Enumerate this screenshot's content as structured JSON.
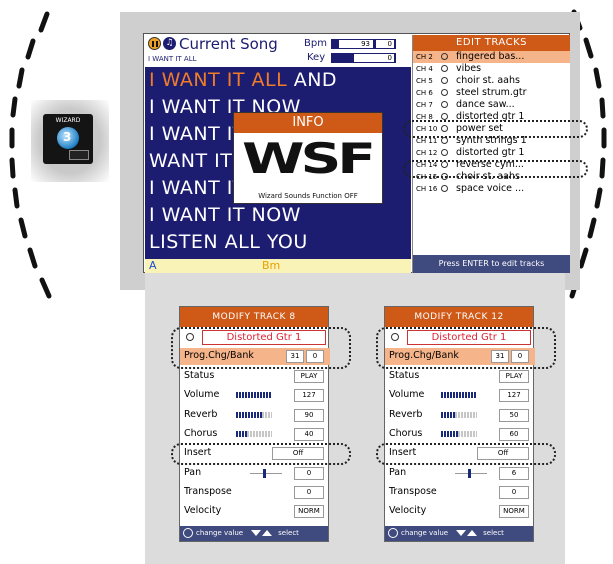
{
  "wizard": {
    "label": "WIZARD",
    "icon": "wizard-disc-icon"
  },
  "song": {
    "title": "Current Song",
    "subtitle": "I WANT IT ALL",
    "bpm_label": "Bpm",
    "bpm_value": "93",
    "bpm_extra": "0",
    "key_label": "Key",
    "key_value": "0",
    "lyrics": [
      {
        "hl": "I WANT IT ALL",
        "rest": " AND"
      },
      {
        "hl": "",
        "rest": "I WANT IT NOW"
      },
      {
        "hl": "",
        "rest": "I WANT IT ALL"
      },
      {
        "hl": "",
        "rest": "WANT IT ALL"
      },
      {
        "hl": "",
        "rest": "I WANT IT ALL AND"
      },
      {
        "hl": "",
        "rest": "I WANT IT NOW"
      },
      {
        "hl": "",
        "rest": "LISTEN ALL YOU"
      }
    ],
    "chord_current": "A",
    "chord_next": "Bm"
  },
  "info": {
    "title": "INFO",
    "logo": "WSF",
    "message": "Wizard Sounds Function OFF"
  },
  "tracks": {
    "title": "EDIT TRACKS",
    "items": [
      {
        "ch": "CH 2",
        "name": "fingered bas...",
        "selected": true
      },
      {
        "ch": "CH 4",
        "name": "vibes",
        "selected": false
      },
      {
        "ch": "CH 5",
        "name": "choir st. aahs",
        "selected": false
      },
      {
        "ch": "CH 6",
        "name": "steel strum.gtr",
        "selected": false
      },
      {
        "ch": "CH 7",
        "name": "dance saw...",
        "selected": false
      },
      {
        "ch": "CH 8",
        "name": "distorted gtr 1",
        "selected": false
      },
      {
        "ch": "CH 10",
        "name": "power set",
        "selected": false
      },
      {
        "ch": "CH 11",
        "name": "synth strings 1",
        "selected": false
      },
      {
        "ch": "CH 12",
        "name": "distorted gtr 1",
        "selected": false
      },
      {
        "ch": "CH 14",
        "name": "reverse cym...",
        "selected": false
      },
      {
        "ch": "CH 15",
        "name": "choir st. aahs",
        "selected": false
      },
      {
        "ch": "CH 16",
        "name": "space voice ...",
        "selected": false
      }
    ],
    "footer": "Press ENTER to edit tracks"
  },
  "modify": [
    {
      "title": "MODIFY TRACK 8",
      "sound": "Distorted Gtr 1",
      "prog_label": "Prog.Chg/Bank",
      "prog_value": "31",
      "bank_value": "0",
      "status_label": "Status",
      "status_value": "PLAY",
      "volume_label": "Volume",
      "volume_value": "127",
      "volume_fill": 1.0,
      "reverb_label": "Reverb",
      "reverb_value": "90",
      "reverb_fill": 0.71,
      "chorus_label": "Chorus",
      "chorus_value": "40",
      "chorus_fill": 0.31,
      "insert_label": "Insert",
      "insert_value": "Off",
      "pan_label": "Pan",
      "pan_value": "0",
      "transpose_label": "Transpose",
      "transpose_value": "0",
      "velocity_label": "Velocity",
      "velocity_value": "NORM",
      "foot_change": "change value",
      "foot_select": "select"
    },
    {
      "title": "MODIFY TRACK 12",
      "sound": "Distorted Gtr 1",
      "prog_label": "Prog.Chg/Bank",
      "prog_value": "31",
      "bank_value": "0",
      "status_label": "Status",
      "status_value": "PLAY",
      "volume_label": "Volume",
      "volume_value": "127",
      "volume_fill": 1.0,
      "reverb_label": "Reverb",
      "reverb_value": "50",
      "reverb_fill": 0.39,
      "chorus_label": "Chorus",
      "chorus_value": "60",
      "chorus_fill": 0.47,
      "insert_label": "Insert",
      "insert_value": "Off",
      "pan_label": "Pan",
      "pan_value": "6",
      "transpose_label": "Transpose",
      "transpose_value": "0",
      "velocity_label": "Velocity",
      "velocity_value": "NORM",
      "foot_change": "change value",
      "foot_select": "select"
    }
  ],
  "colors": {
    "accent": "#cf5a18",
    "lyrics_bg": "#1c1c70",
    "highlight": "#f07c28",
    "selected_row": "#f6b48a",
    "footer": "#3f4a7e"
  }
}
